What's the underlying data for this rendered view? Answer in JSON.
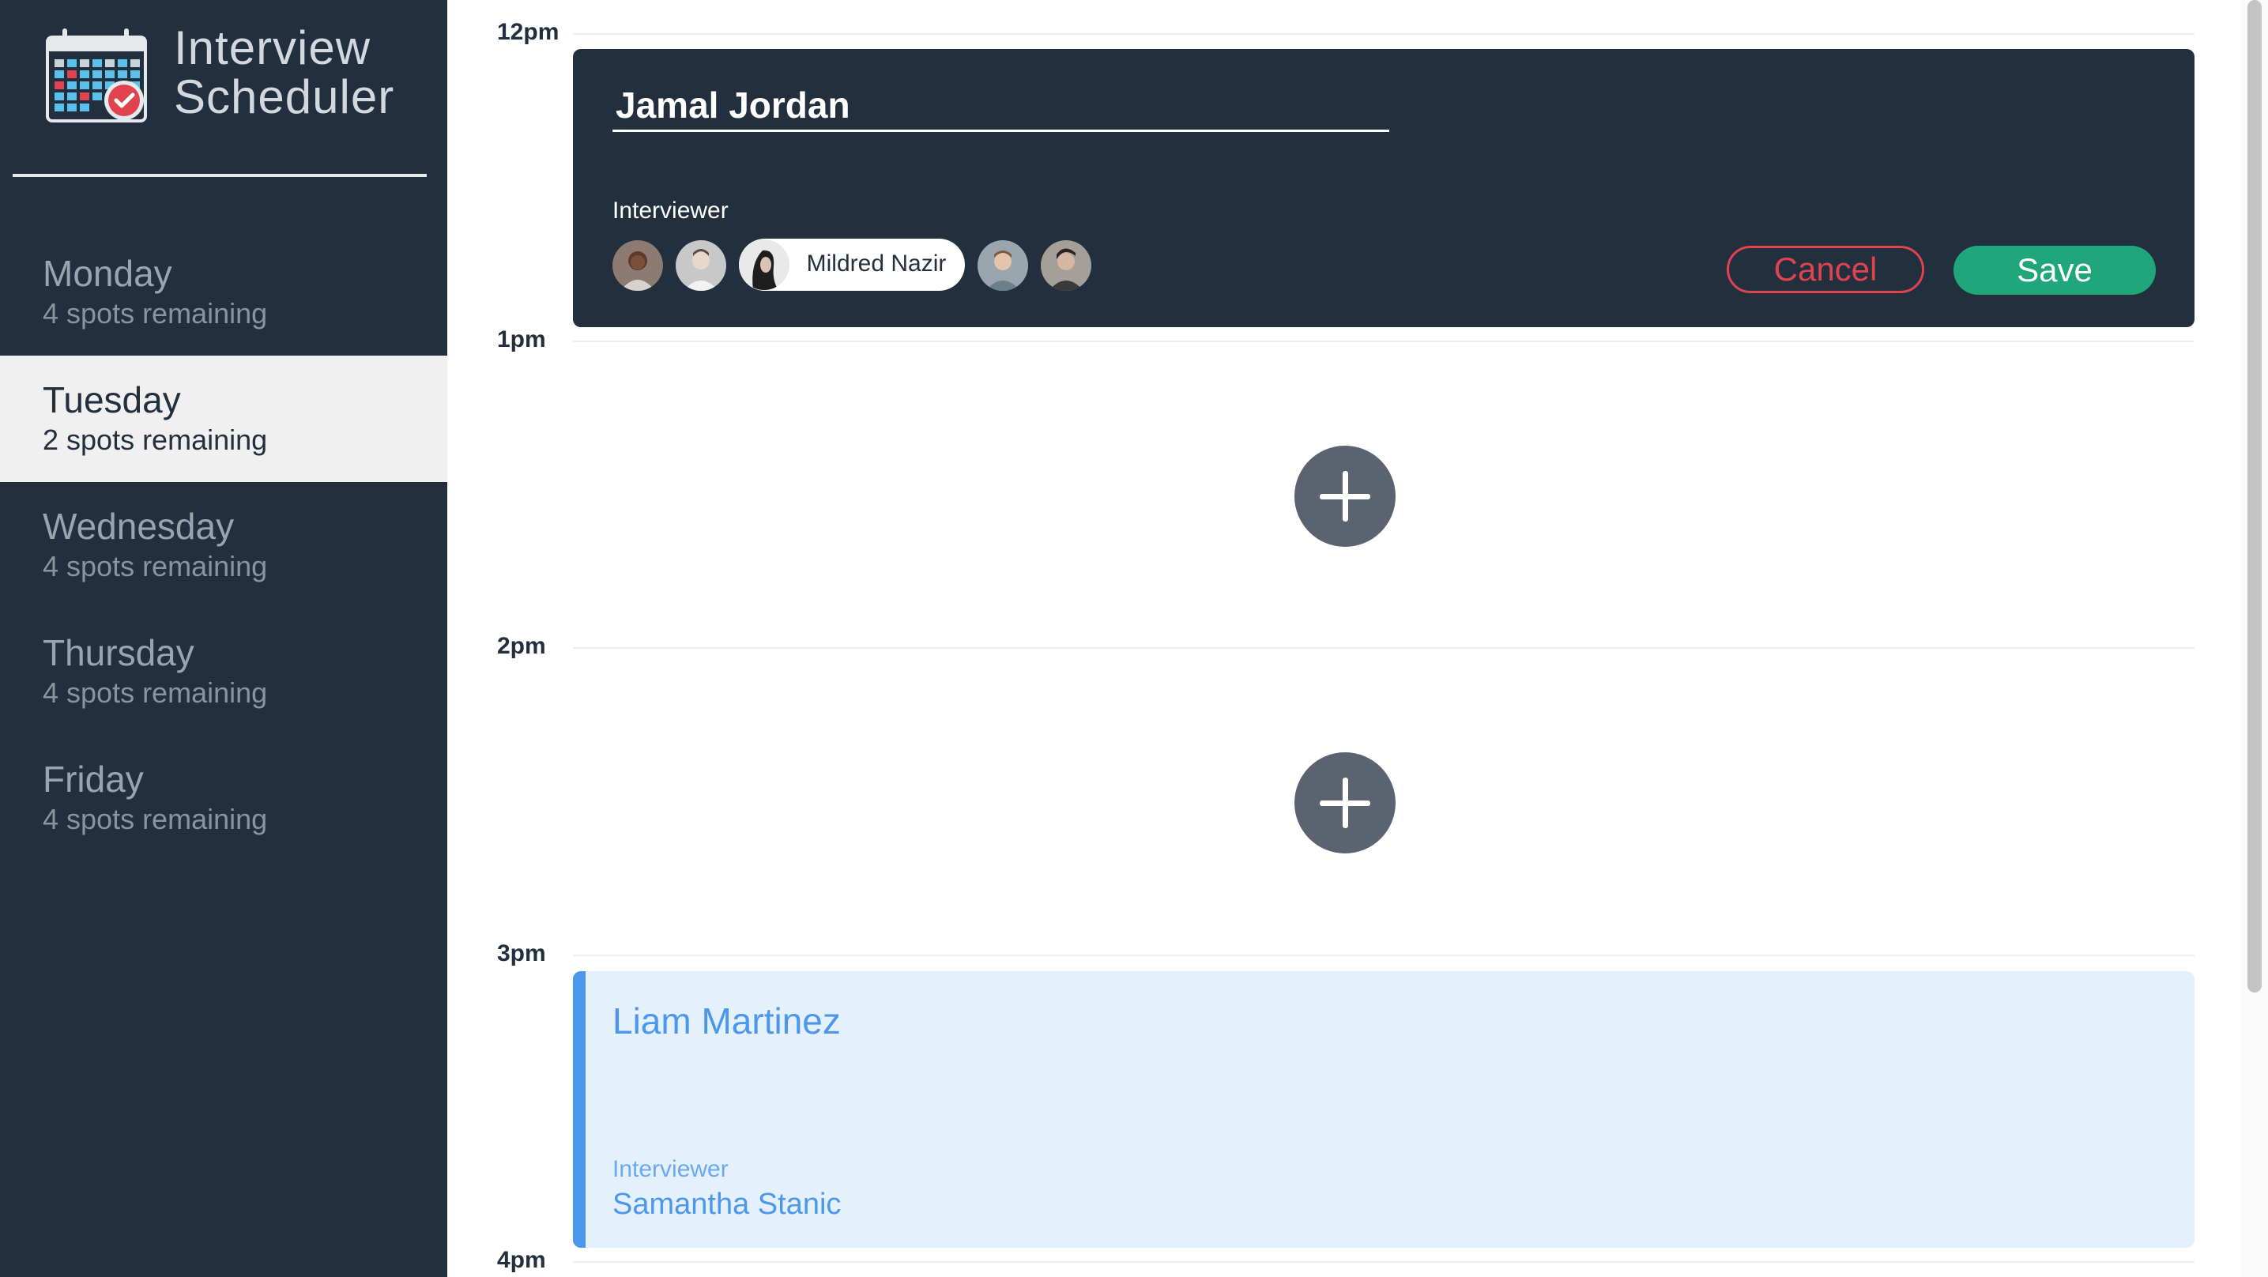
{
  "app": {
    "title_line1": "Interview",
    "title_line2": "Scheduler"
  },
  "sidebar": {
    "days": [
      {
        "name": "Monday",
        "spots": "4 spots remaining",
        "selected": false
      },
      {
        "name": "Tuesday",
        "spots": "2 spots remaining",
        "selected": true
      },
      {
        "name": "Wednesday",
        "spots": "4 spots remaining",
        "selected": false
      },
      {
        "name": "Thursday",
        "spots": "4 spots remaining",
        "selected": false
      },
      {
        "name": "Friday",
        "spots": "4 spots remaining",
        "selected": false
      }
    ]
  },
  "schedule": {
    "hours": [
      "12pm",
      "1pm",
      "2pm",
      "3pm",
      "4pm"
    ]
  },
  "edit_form": {
    "student_value": "Jamal Jordan",
    "interviewer_label": "Interviewer",
    "selected_interviewer": "Mildred Nazir",
    "cancel_label": "Cancel",
    "save_label": "Save"
  },
  "booked": {
    "student": "Liam Martinez",
    "interviewer_label": "Interviewer",
    "interviewer": "Samantha Stanic"
  },
  "colors": {
    "sidebar_bg": "#222f3e",
    "cancel": "#e0424e",
    "save": "#1fa67a",
    "booked_accent": "#4a97ec"
  }
}
